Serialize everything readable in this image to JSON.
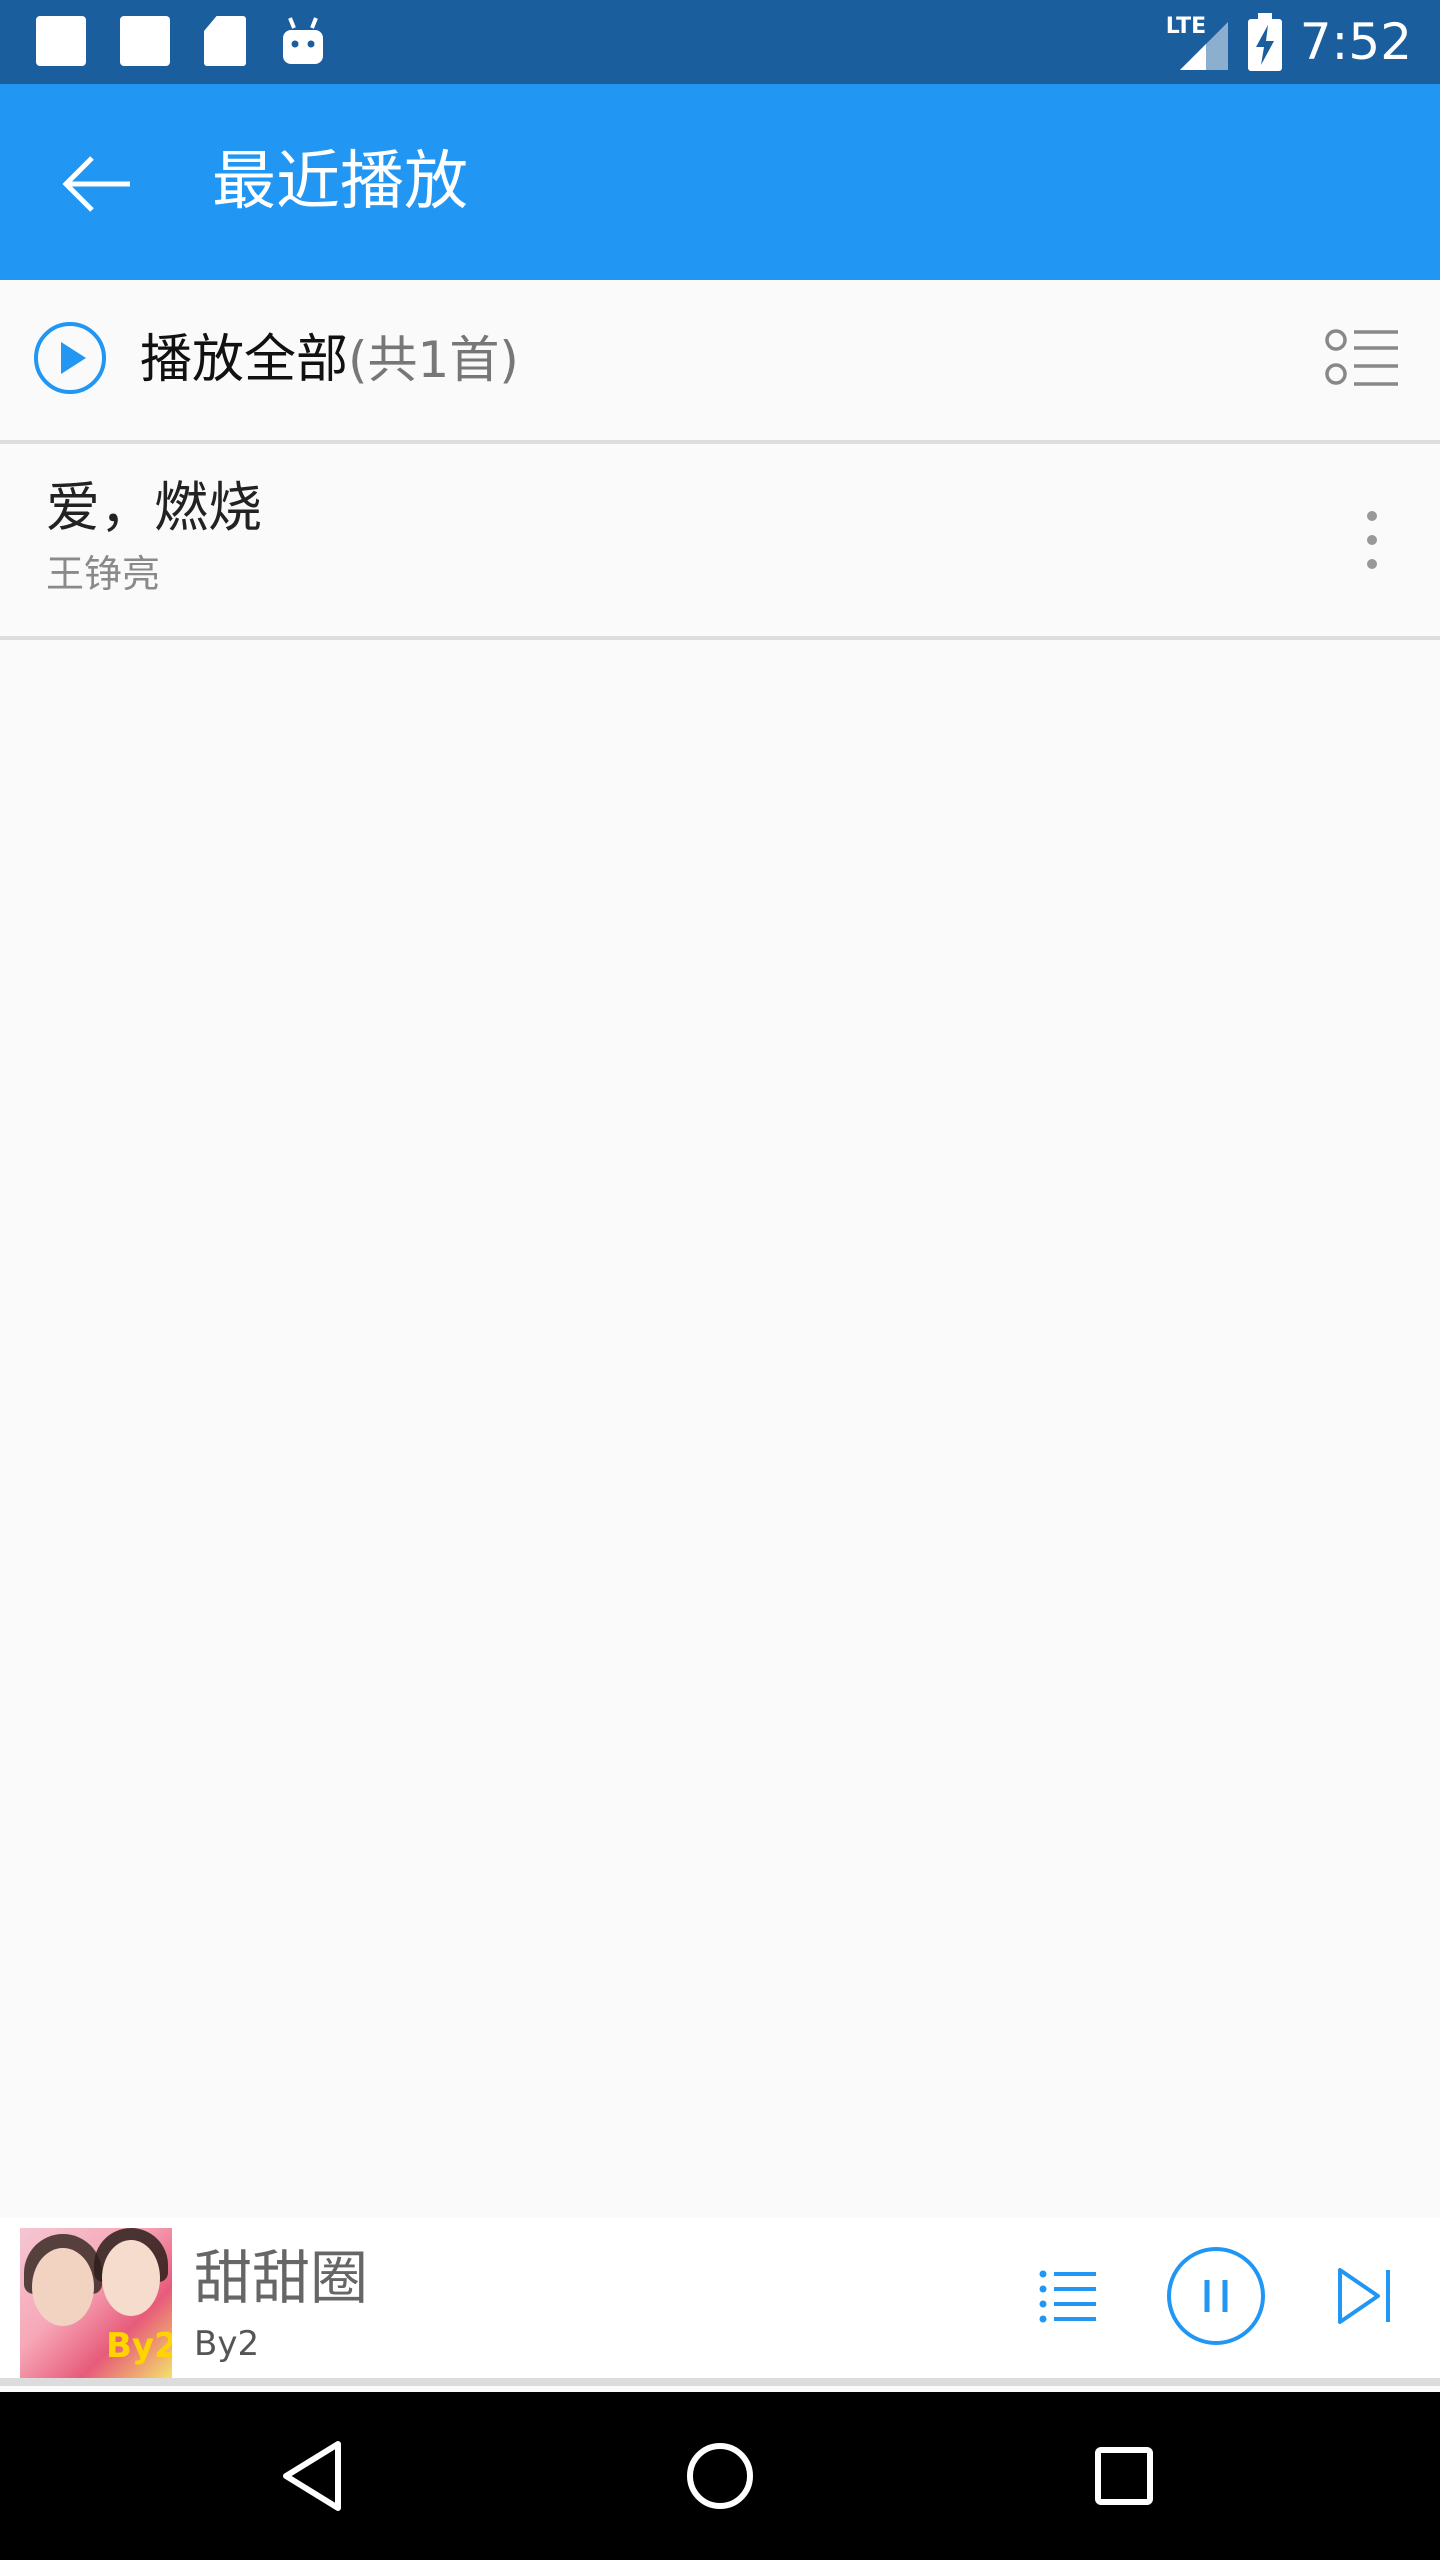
{
  "status_bar": {
    "time": "7:52",
    "network": "LTE"
  },
  "app_bar": {
    "title": "最近播放"
  },
  "play_all": {
    "label": "播放全部",
    "count": "(共1首)"
  },
  "songs": [
    {
      "title": "爱，燃烧",
      "artist": "王铮亮"
    }
  ],
  "now_playing": {
    "title": "甜甜圈",
    "artist": "By2",
    "cover_text": "By2"
  },
  "colors": {
    "status_bar": "#1A5E9E",
    "app_bar": "#2196F3",
    "accent": "#2196F3",
    "background": "#FAFAFA"
  },
  "icons": {
    "back": "arrow-left-icon",
    "play_all": "play-circle-icon",
    "multi_select": "list-select-icon",
    "more": "more-vertical-icon",
    "playlist": "playlist-icon",
    "pause": "pause-circle-icon",
    "next": "skip-next-icon"
  }
}
